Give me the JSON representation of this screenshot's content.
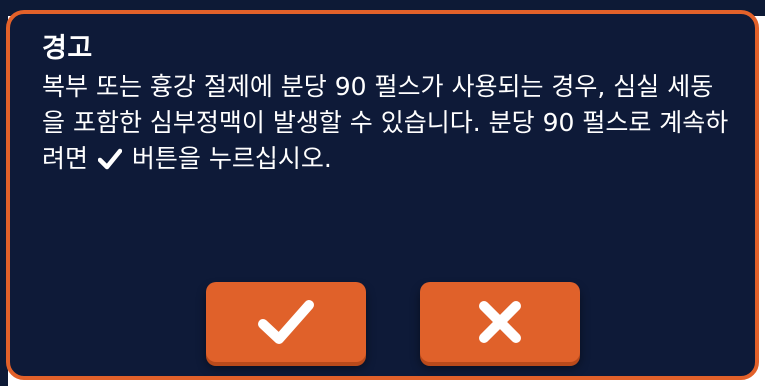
{
  "dialog": {
    "title": "경고",
    "message_before_icon": "복부 또는 흉강 절제에 분당 90 펄스가 사용되는 경우, 심실 세동을 포함한 심부정맥이 발생할 수 있습니다. 분당 90 펄스로 계속하려면",
    "inline_icon": "checkmark-icon",
    "message_after_icon": "버튼을 누르십시오."
  },
  "buttons": {
    "confirm_icon": "checkmark-icon",
    "cancel_icon": "close-icon"
  },
  "colors": {
    "background": "#0e1a38",
    "border": "#e2612a",
    "button": "#e0612a",
    "text": "#ffffff"
  }
}
